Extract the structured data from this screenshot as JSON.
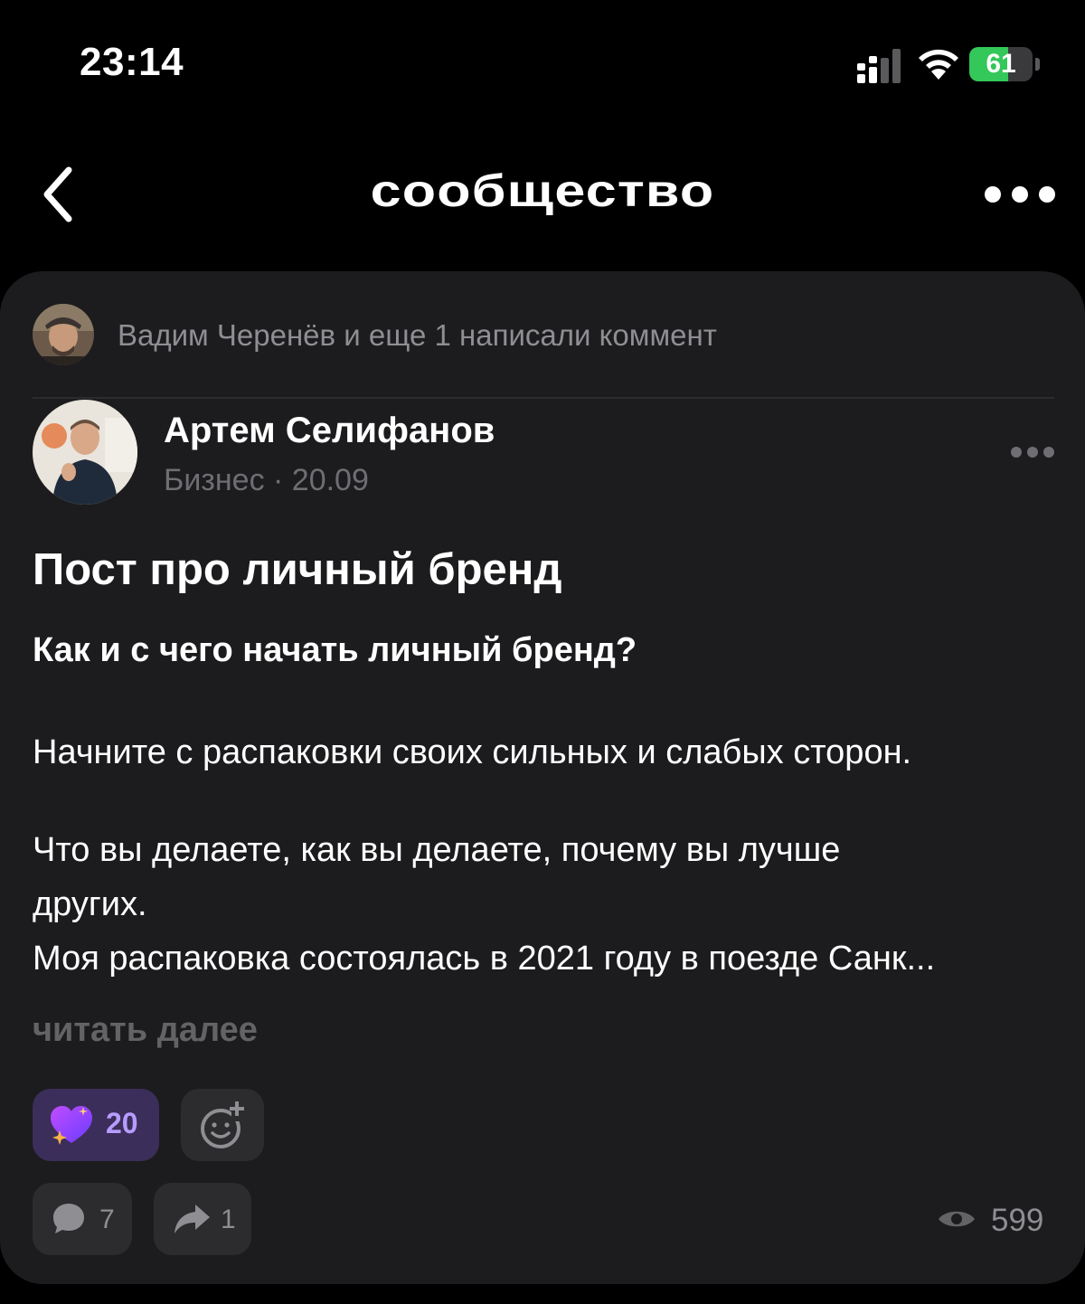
{
  "status_bar": {
    "time": "23:14",
    "battery_level": "61",
    "battery_fill_percent": 61,
    "battery_color": "#34c759"
  },
  "nav": {
    "title": "сообщество",
    "back_icon": "chevron-left-icon",
    "more_icon": "more-horizontal-icon"
  },
  "post": {
    "activity_text": "Вадим Черенёв и еще 1 написали коммент",
    "author_name": "Артем Селифанов",
    "author_meta": "Бизнес · 20.09",
    "title": "Пост про личный бренд",
    "subtitle": "Как и с чего начать личный бренд?",
    "body": [
      "Начните с распаковки своих сильных и слабых сторон.",
      "Что вы делаете, как вы делаете, почему вы лучше",
      "других.",
      "Моя распаковка состоялась в 2021 году в поезде Санк..."
    ],
    "read_more": "читать далее",
    "reaction_count": "20",
    "comment_count": "7",
    "share_count": "1",
    "view_count": "599",
    "accent_color": "#b79cff"
  }
}
